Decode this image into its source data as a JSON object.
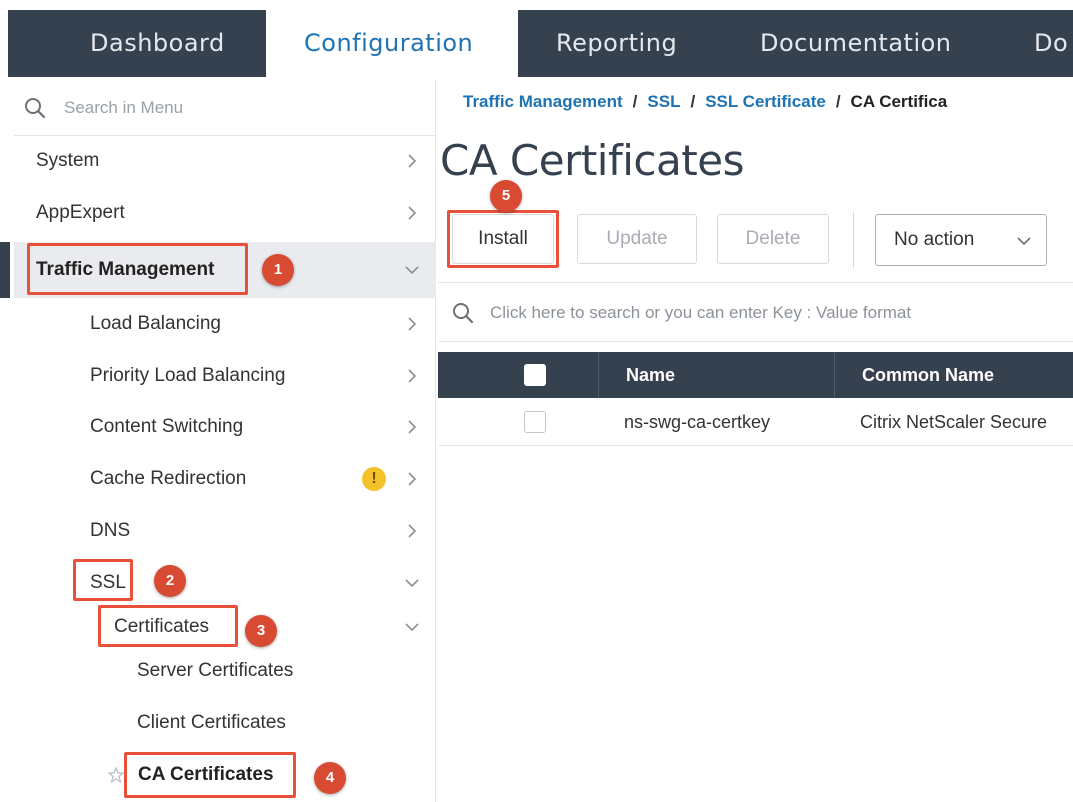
{
  "nav": {
    "tabs": [
      {
        "label": "Dashboard"
      },
      {
        "label": "Configuration"
      },
      {
        "label": "Reporting"
      },
      {
        "label": "Documentation"
      },
      {
        "label": "Do"
      }
    ],
    "active_tab": "Configuration"
  },
  "sidebar": {
    "search_placeholder": "Search in Menu",
    "items": [
      {
        "label": "System"
      },
      {
        "label": "AppExpert"
      },
      {
        "label": "Traffic Management"
      },
      {
        "label": "Load Balancing"
      },
      {
        "label": "Priority Load Balancing"
      },
      {
        "label": "Content Switching"
      },
      {
        "label": "Cache Redirection"
      },
      {
        "label": "DNS"
      },
      {
        "label": "SSL"
      },
      {
        "label": "Certificates"
      },
      {
        "label": "Server Certificates"
      },
      {
        "label": "Client Certificates"
      },
      {
        "label": "CA Certificates"
      }
    ],
    "warning_glyph": "!"
  },
  "callouts": [
    "1",
    "2",
    "3",
    "4",
    "5"
  ],
  "breadcrumb": {
    "items": [
      "Traffic Management",
      "SSL",
      "SSL Certificate"
    ],
    "separator": "/",
    "current": "CA Certifica"
  },
  "page": {
    "title": "CA Certificates"
  },
  "toolbar": {
    "install_label": "Install",
    "update_label": "Update",
    "delete_label": "Delete",
    "action_select_value": "No action"
  },
  "table": {
    "search_placeholder": "Click here to search or you can enter Key : Value format",
    "columns": [
      "Name",
      "Common Name"
    ],
    "rows": [
      {
        "name": "ns-swg-ca-certkey",
        "common_name": "Citrix NetScaler Secure"
      }
    ]
  },
  "colors": {
    "nav_bg": "#364150",
    "link": "#1e73b5",
    "callout": "#e8503a",
    "warning": "#f3c22a"
  },
  "icons": {
    "search": "search-icon",
    "chevron_right": "chevron-right-icon",
    "chevron_down": "chevron-down-icon",
    "warning": "warning-icon",
    "star": "star-icon"
  }
}
